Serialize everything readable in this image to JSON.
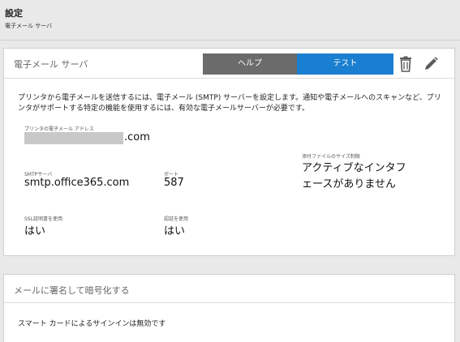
{
  "header": {
    "title": "設定",
    "breadcrumb": "電子メール サーバ"
  },
  "email_card": {
    "title": "電子メール サーバ",
    "help_label": "ヘルプ",
    "test_label": "テスト",
    "delete_icon": "trash-icon",
    "edit_icon": "pencil-icon",
    "description": "プリンタから電子メールを送信するには、電子メール (SMTP) サーバーを設定します。通知や電子メールへのスキャンなど、プリンタがサポートする特定の機能を使用するには、有効な電子メールサーバーが必要です。",
    "printer_email_label": "プリンタの電子メール アドレス",
    "printer_email_suffix": ".com",
    "smtp_label": "SMTPサーバ",
    "smtp_value": "smtp.office365.com",
    "port_label": "ポート",
    "port_value": "587",
    "attach_label": "添付ファイルのサイズ制限",
    "attach_value": "アクティブなインタフェースがありません",
    "ssl_label": "SSL証明書を使用",
    "ssl_value": "はい",
    "auth_label": "認証を使用",
    "auth_value": "はい"
  },
  "sign_card": {
    "title": "メールに署名して暗号化する",
    "body": "スマート カードによるサインインは無効です"
  },
  "colors": {
    "help_button": "#6b6b6b",
    "test_button": "#1a7fd0",
    "background": "#e9e9e9"
  }
}
